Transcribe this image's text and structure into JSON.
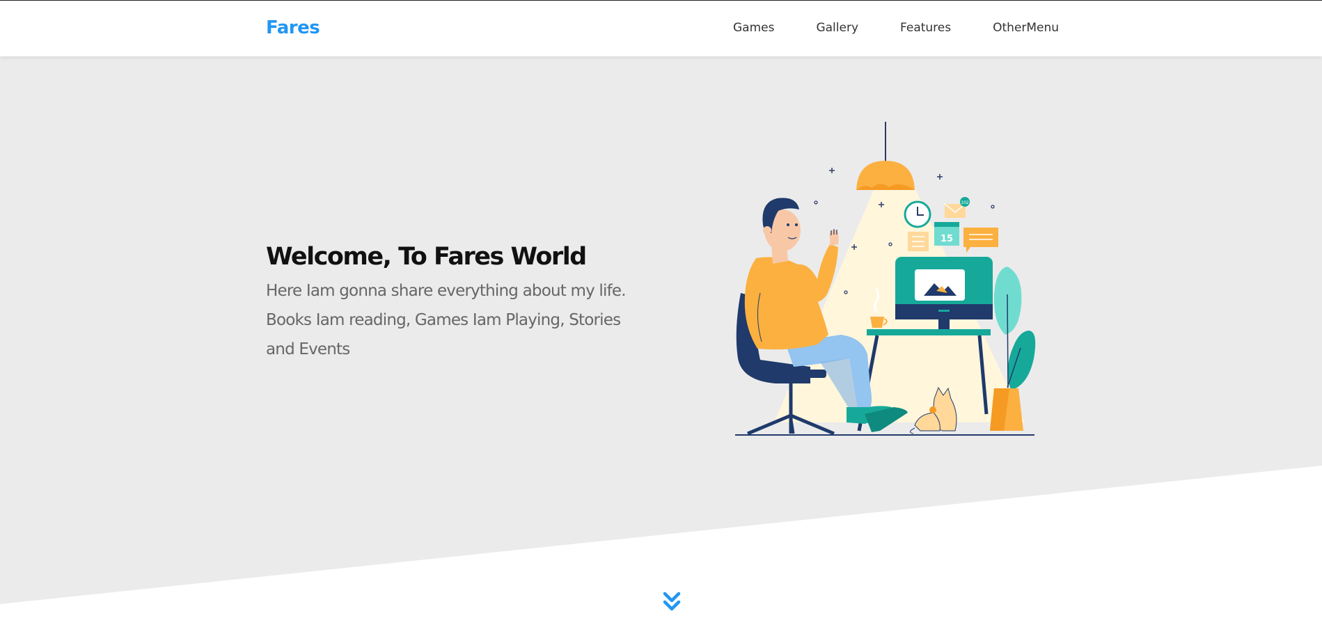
{
  "brand": {
    "name": "Fares",
    "color": "#2196f3"
  },
  "nav": {
    "items": [
      {
        "label": "Games"
      },
      {
        "label": "Gallery"
      },
      {
        "label": "Features"
      },
      {
        "label": "OtherMenu"
      }
    ]
  },
  "hero": {
    "title": "Welcome, To Fares World",
    "description": "Here Iam gonna share everything about my life. Books Iam reading, Games Iam Playing, Stories and Events",
    "background_color": "#ebebeb",
    "illustration": {
      "icon": "person-at-desk-illustration",
      "calendar_day": "15",
      "badge_count": "102"
    }
  },
  "scroll": {
    "icon": "double-chevron-down-icon"
  }
}
